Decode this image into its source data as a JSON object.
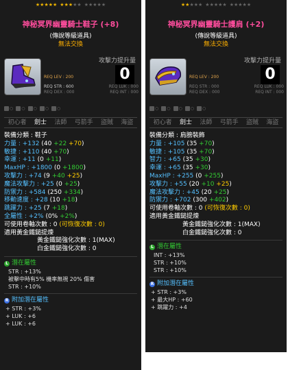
{
  "colors": {
    "title": "#ff4d9d",
    "trade": "#ffb000",
    "bonus": "#33cc33",
    "enhance": "#ffcc00",
    "blue": "#55c0ff",
    "req_lev": "#e3a64c"
  },
  "panels": [
    {
      "title": "神秘冥界幽靈騎士鞋子 (+8)",
      "grade": "(傳說等級道具)",
      "trade": "無法交換",
      "stars_filled": 8,
      "attack_label": "攻擊力提升量",
      "attack_value": "0",
      "req_lev": "REQ LEV : 200",
      "req_str": "REQ STR : 600",
      "req_luk": "REQ LUK : 000",
      "req_dex": "REQ DEX : 000",
      "req_int": "REQ INT : 000",
      "icon": "shoe-icon",
      "jobs": [
        "初心者",
        "劍士",
        "法師",
        "弓箭手",
        "盜賊",
        "海盜"
      ],
      "active_job": 1,
      "category": "裝備分類 : 鞋子",
      "stats": [
        {
          "label": "力量 : +132",
          "base": " (40 ",
          "add": "+22 ",
          "enh": "+70",
          "end": ")"
        },
        {
          "label": "敏捷 : +110",
          "base": " (40 ",
          "add": "+70",
          "enh": "",
          "end": ")"
        },
        {
          "label": "幸運 : +11",
          "base": " (0 ",
          "add": "+11",
          "enh": "",
          "end": ")"
        },
        {
          "label": "MaxHP : +1800",
          "base": " (0 ",
          "add": "+1800",
          "enh": "",
          "end": ")"
        },
        {
          "label": "攻擊力 : +74",
          "base": " (9 ",
          "add": "+40 ",
          "enh": "+25",
          "end": ")"
        },
        {
          "label": "魔法攻擊力 : +25",
          "base": " (0 ",
          "add": "+25",
          "enh": "",
          "end": ")"
        },
        {
          "label": "防禦力 : +584",
          "base": " (250 ",
          "add": "+334",
          "enh": "",
          "end": ")"
        },
        {
          "label": "移動速度 : +28",
          "base": " (10 ",
          "add": "+18",
          "enh": "",
          "end": ")"
        },
        {
          "label": "跳躍力 : +25",
          "base": " (7 ",
          "add": "+18",
          "enh": "",
          "end": ")"
        },
        {
          "label": "全屬性 : +2%",
          "base": " (0% ",
          "add": "+2%",
          "enh": "",
          "end": ")"
        }
      ],
      "upgrades_line": "可使用卷軸次數 : 0",
      "recover_line": "(可恢復次數 : 0)",
      "hammer_line": "適用黃金鐵鎚提煉",
      "hammer_count": "黃金鐵鎚強化次數 : 1(MAX)",
      "platinum_count": "白金鐵鎚強化次數 : 0",
      "potential_title": "潛在屬性",
      "potential": [
        "STR : +13%",
        "被擊中時有5% 機率無視 20% 傷害",
        "STR : +10%"
      ],
      "bonus_title": "附加潛在屬性",
      "bonus": [
        "+ STR : +3%",
        "+ LUK : +6",
        "+ LUK : +6"
      ]
    },
    {
      "title": "神秘冥界幽靈騎士護肩 (+2)",
      "grade": "(傳說等級道具)",
      "trade": "無法交換",
      "stars_filled": 2,
      "attack_label": "攻擊力提升量",
      "attack_value": "0",
      "req_lev": "REQ LEV : 200",
      "req_str": "REQ STR : 000",
      "req_luk": "REQ LUK : 000",
      "req_dex": "REQ DEX : 000",
      "req_int": "REQ INT : 000",
      "icon": "shoulder-icon",
      "jobs": [
        "初心者",
        "劍士",
        "法師",
        "弓箭手",
        "盜賊",
        "海盜"
      ],
      "active_job": 1,
      "category": "裝備分類 : 肩膀裝飾",
      "stats": [
        {
          "label": "力量 : +105",
          "base": " (35 ",
          "add": "+70",
          "enh": "",
          "end": ")"
        },
        {
          "label": "敏捷 : +105",
          "base": " (35 ",
          "add": "+70",
          "enh": "",
          "end": ")"
        },
        {
          "label": "智力 : +65",
          "base": " (35 ",
          "add": "+30",
          "enh": "",
          "end": ")"
        },
        {
          "label": "幸運 : +65",
          "base": " (35 ",
          "add": "+30",
          "enh": "",
          "end": ")"
        },
        {
          "label": "MaxHP : +255",
          "base": " (0 ",
          "add": "+255",
          "enh": "",
          "end": ")"
        },
        {
          "label": "攻擊力 : +55",
          "base": " (20 ",
          "add": "+10 ",
          "enh": "+25",
          "end": ")"
        },
        {
          "label": "魔法攻擊力 : +45",
          "base": " (20 ",
          "add": "+25",
          "enh": "",
          "end": ")"
        },
        {
          "label": "防禦力 : +702",
          "base": " (300 ",
          "add": "+402",
          "enh": "",
          "end": ")"
        }
      ],
      "upgrades_line": "可使用卷軸次數 : 0",
      "recover_line": "(可恢復次數 : 0)",
      "hammer_line": "適用黃金鐵鎚提煉",
      "hammer_count": "黃金鐵鎚強化次數 : 1(MAX)",
      "platinum_count": "白金鐵鎚強化次數 : 0",
      "potential_title": "潛在屬性",
      "potential": [
        "INT : +13%",
        "STR : +10%",
        "STR : +10%"
      ],
      "bonus_title": "附加潛在屬性",
      "bonus": [
        "+ STR : +3%",
        "+ 最大HP : +60",
        "+ 跳躍力 : +4"
      ]
    }
  ]
}
